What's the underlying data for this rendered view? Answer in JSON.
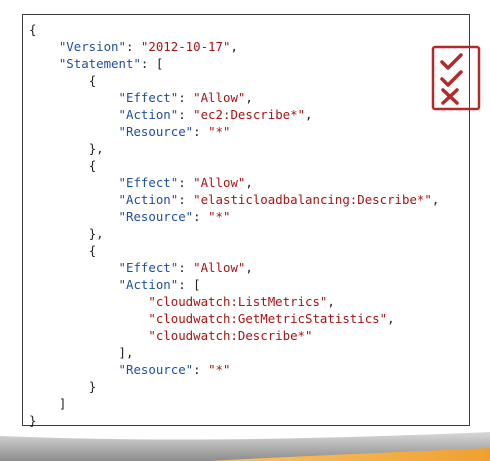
{
  "policy": {
    "open_brace": "{",
    "version_key": "\"Version\"",
    "version_value": "\"2012-10-17\"",
    "statement_key": "\"Statement\"",
    "statements": [
      {
        "effect_key": "\"Effect\"",
        "effect_value": "\"Allow\"",
        "action_key": "\"Action\"",
        "action_value": "\"ec2:Describe*\"",
        "resource_key": "\"Resource\"",
        "resource_value": "\"*\""
      },
      {
        "effect_key": "\"Effect\"",
        "effect_value": "\"Allow\"",
        "action_key": "\"Action\"",
        "action_value": "\"elasticloadbalancing:Describe*\"",
        "resource_key": "\"Resource\"",
        "resource_value": "\"*\""
      },
      {
        "effect_key": "\"Effect\"",
        "effect_value": "\"Allow\"",
        "action_key": "\"Action\"",
        "action_values": [
          "\"cloudwatch:ListMetrics\"",
          "\"cloudwatch:GetMetricStatistics\"",
          "\"cloudwatch:Describe*\""
        ],
        "resource_key": "\"Resource\"",
        "resource_value": "\"*\""
      }
    ],
    "close_brace": "}"
  },
  "icon": {
    "name": "checklist-icon",
    "color": "#b32a2a"
  },
  "colors": {
    "key": "#1f4e9e",
    "string": "#a31515",
    "border": "#3a3a3a",
    "accent_band": "#f0a030"
  }
}
